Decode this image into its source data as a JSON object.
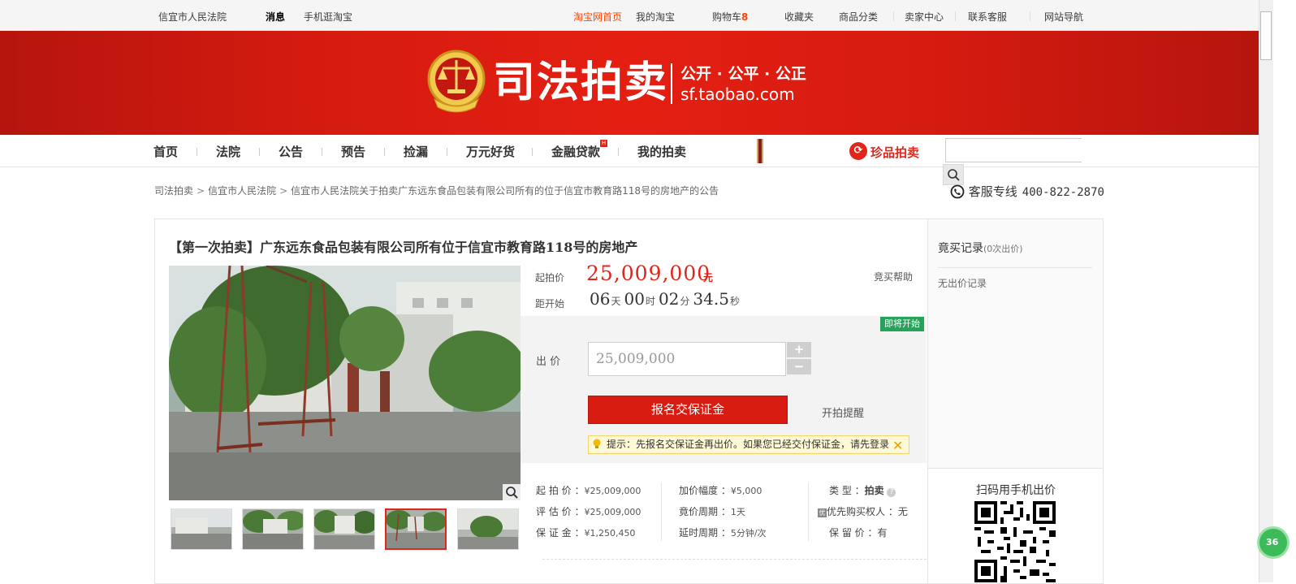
{
  "topbar": {
    "court": "信宜市人民法院",
    "messages": "消息",
    "mobile": "手机逛淘宝",
    "home": "淘宝网首页",
    "my_taobao": "我的淘宝",
    "cart": "购物车",
    "cart_count": "8",
    "favorites": "收藏夹",
    "categories": "商品分类",
    "seller": "卖家中心",
    "service": "联系客服",
    "sitemap": "网站导航"
  },
  "banner": {
    "title": "司法拍卖",
    "slogan": "公开 · 公平 · 公正",
    "url": "sf.taobao.com"
  },
  "nav": {
    "items": [
      "首页",
      "法院",
      "公告",
      "预告",
      "捡漏",
      "万元好货",
      "金融贷款",
      "我的拍卖"
    ],
    "loan_badge": "H",
    "zhenpin": "珍品拍卖",
    "search_placeholder": ""
  },
  "breadcrumb": {
    "root": "司法拍卖",
    "court": "信宜市人民法院",
    "current": "信宜市人民法院关于拍卖广东远东食品包装有限公司所有的位于信宜市教育路118号的房地产的公告"
  },
  "hotline": {
    "label": "客服专线",
    "number": "400-822-2870"
  },
  "item": {
    "title": "【第一次拍卖】广东远东食品包装有限公司所有位于信宜市教育路118号的房地产",
    "start_price_label": "起拍价",
    "start_price": "25,009,000",
    "start_unit": "元",
    "help": "竞买帮助",
    "countdown_label": "距开始",
    "countdown": {
      "days": "06",
      "days_u": "天",
      "hours": "00",
      "hours_u": "时",
      "minutes": "02",
      "minutes_u": "分",
      "seconds": "34.5",
      "seconds_u": "秒"
    },
    "soon_badge": "即将开始",
    "bid_label": "出 价",
    "bid_value": "25,009,000",
    "plus": "+",
    "minus": "−",
    "apply_button": "报名交保证金",
    "remind": "开拍提醒",
    "tip": "提示：先报名交保证金再出价。如果您已经交付保证金，请先登录",
    "tip_close": "✕"
  },
  "info": {
    "start_price_label": "起 拍 价 ：",
    "start_price": "¥25,009,000",
    "appraisal_label": "评 估 价 ：",
    "appraisal": "¥25,009,000",
    "deposit_label": "保 证 金 ：",
    "deposit": "¥1,250,450",
    "increment_label": "加价幅度 ：",
    "increment": "¥5,000",
    "cycle_label": "竟价周期 ：",
    "cycle": "1天",
    "delay_label": "延时周期 ：",
    "delay": "5分钟/次",
    "type_label": "类 型 ：",
    "type": "拍卖",
    "priority_label": "优先购买权人 ：",
    "priority": "无",
    "reserve_label": "保 留 价 ：",
    "reserve": "有"
  },
  "side": {
    "title": "竟买记录",
    "count": "(0次出价)",
    "empty": "无出价记录",
    "qr_title": "扫码用手机出价"
  },
  "floater": "36",
  "colors": {
    "brand_red": "#e0261b",
    "banner_red": "#d51b10",
    "badge_green": "#25a35a"
  }
}
